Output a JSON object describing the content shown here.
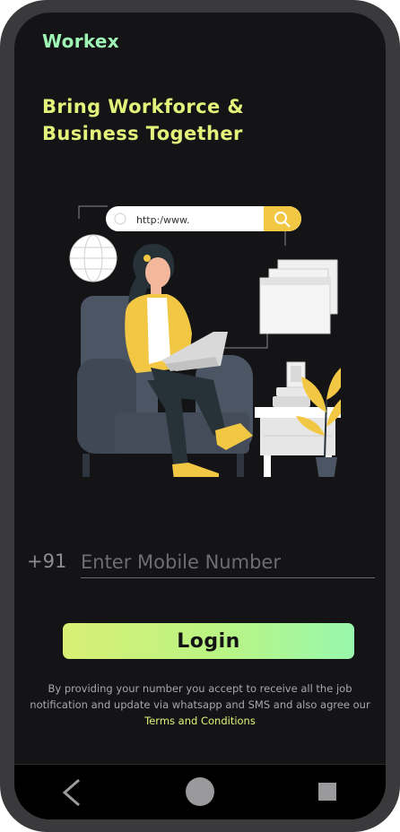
{
  "app": {
    "brand": "Workex",
    "headline": "Bring Workforce & Business Together"
  },
  "illustration": {
    "url_text": "http:/www."
  },
  "form": {
    "country_code": "+91",
    "mobile_placeholder": "Enter Mobile Number",
    "login_label": "Login"
  },
  "disclaimer": {
    "text": "By providing your number you accept to receive all the job notification and update via whatsapp and SMS and also agree our",
    "terms_link": "Terms and Conditions"
  },
  "colors": {
    "accent_yellow": "#e2f27a",
    "accent_green": "#9ef5b4",
    "background": "#141416"
  },
  "navbar": {
    "icons": [
      "back-icon",
      "home-icon",
      "recent-apps-icon"
    ]
  }
}
